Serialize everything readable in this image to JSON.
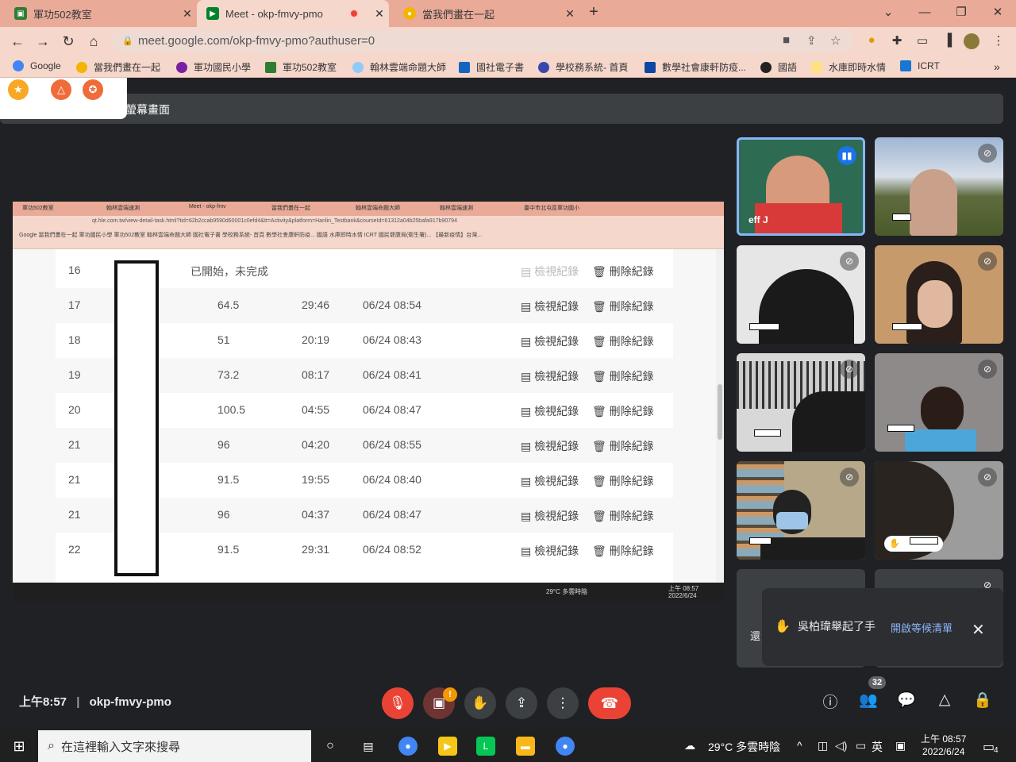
{
  "browser": {
    "tabs": [
      {
        "title": "軍功502教室",
        "favicon_color": "#2e7d32"
      },
      {
        "title": "Meet - okp-fmvy-pmo",
        "favicon_color": "#00832d"
      },
      {
        "title": "當我們畫在一起",
        "favicon_color": "#f4b400"
      }
    ],
    "url": "meet.google.com/okp-fmvy-pmo?authuser=0",
    "bookmarks": [
      "Google",
      "當我們畫在一起",
      "軍功國民小學",
      "軍功502教室",
      "翰林雲端命題大師",
      "國社電子書",
      "學校務系統- 首頁",
      "數學社會康軒防疫...",
      "國語",
      "水庫即時水情",
      "ICRT"
    ]
  },
  "meet": {
    "presenting_label": "螢幕畫面",
    "meeting_code": "okp-fmvy-pmo",
    "time": "上午8:57",
    "participant_count": "32",
    "speaker_name": "eff J",
    "hand_toast": {
      "text": "吳柏瑋舉起了手",
      "link": "開啟等候清單"
    },
    "peek_label": "還"
  },
  "shared_screen": {
    "tabs": [
      "軍功502教室",
      "翰林雲端速測",
      "Meet - okp-fmv",
      "當我們畫在一起",
      "翰林雲端命題大師",
      "翰林雲端速測",
      "臺中市北屯區軍功國小"
    ],
    "url": "qt.hle.com.tw/view-detail-task.html?tid=62b2ccab9590d60001c0efd4&tt=Activity&platform=Hanlin_Testbank&courseId=61312a04b25bafa917b90794",
    "bookmarks": "Google  當我們畫在一起  軍功國民小學  軍功502教室  翰林雲端命題大師  國社電子書  學校務系統- 首頁  數學社會康軒防疫...  國語  水庫即時水情  ICRT  國民健康局(衛生署)...  【最新疫情】台灣...",
    "view_label": "檢視紀錄",
    "delete_label": "刪除紀錄",
    "rows": [
      {
        "no": "16",
        "score": "已開始，未完成",
        "time": "",
        "date": ""
      },
      {
        "no": "17",
        "score": "64.5",
        "time": "29:46",
        "date": "06/24 08:54"
      },
      {
        "no": "18",
        "score": "51",
        "time": "20:19",
        "date": "06/24 08:43"
      },
      {
        "no": "19",
        "score": "73.2",
        "time": "08:17",
        "date": "06/24 08:41"
      },
      {
        "no": "20",
        "score": "100.5",
        "time": "04:55",
        "date": "06/24 08:47"
      },
      {
        "no": "21",
        "score": "96",
        "time": "04:20",
        "date": "06/24 08:55"
      },
      {
        "no": "21",
        "score": "91.5",
        "time": "19:55",
        "date": "06/24 08:40"
      },
      {
        "no": "21",
        "score": "96",
        "time": "04:37",
        "date": "06/24 08:47"
      },
      {
        "no": "22",
        "score": "91.5",
        "time": "29:31",
        "date": "06/24 08:52"
      }
    ],
    "taskbar_weather": "29°C 多雲時陰",
    "taskbar_time": "上午 08:57",
    "taskbar_date": "2022/6/24"
  },
  "taskbar": {
    "search_placeholder": "在這裡輸入文字來搜尋",
    "weather": "29°C 多雲時陰",
    "ime": "英",
    "time": "上午 08:57",
    "date": "2022/6/24",
    "notif_count": "4"
  },
  "icons": {
    "hand": "✋",
    "mic_off": "mic-off",
    "more": "⋮"
  }
}
